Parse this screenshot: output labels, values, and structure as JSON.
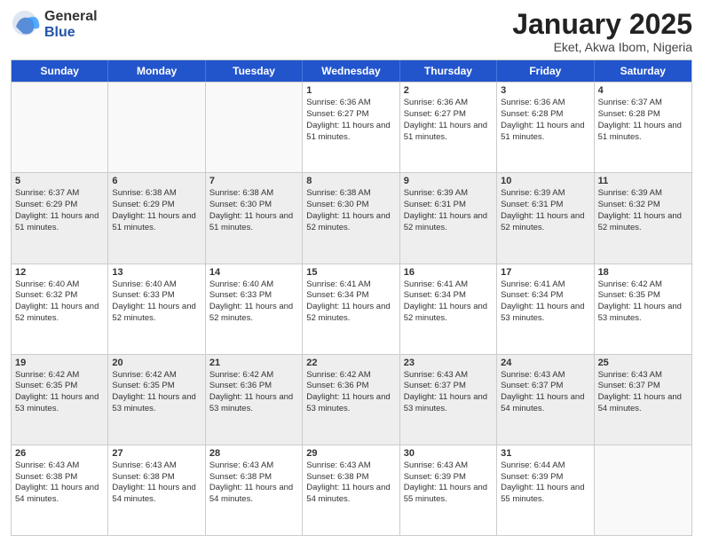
{
  "logo": {
    "general": "General",
    "blue": "Blue"
  },
  "title": {
    "month": "January 2025",
    "location": "Eket, Akwa Ibom, Nigeria"
  },
  "header_days": [
    "Sunday",
    "Monday",
    "Tuesday",
    "Wednesday",
    "Thursday",
    "Friday",
    "Saturday"
  ],
  "weeks": [
    [
      {
        "day": "",
        "empty": true
      },
      {
        "day": "",
        "empty": true
      },
      {
        "day": "",
        "empty": true
      },
      {
        "day": "1",
        "sunrise": "Sunrise: 6:36 AM",
        "sunset": "Sunset: 6:27 PM",
        "daylight": "Daylight: 11 hours and 51 minutes."
      },
      {
        "day": "2",
        "sunrise": "Sunrise: 6:36 AM",
        "sunset": "Sunset: 6:27 PM",
        "daylight": "Daylight: 11 hours and 51 minutes."
      },
      {
        "day": "3",
        "sunrise": "Sunrise: 6:36 AM",
        "sunset": "Sunset: 6:28 PM",
        "daylight": "Daylight: 11 hours and 51 minutes."
      },
      {
        "day": "4",
        "sunrise": "Sunrise: 6:37 AM",
        "sunset": "Sunset: 6:28 PM",
        "daylight": "Daylight: 11 hours and 51 minutes."
      }
    ],
    [
      {
        "day": "5",
        "sunrise": "Sunrise: 6:37 AM",
        "sunset": "Sunset: 6:29 PM",
        "daylight": "Daylight: 11 hours and 51 minutes."
      },
      {
        "day": "6",
        "sunrise": "Sunrise: 6:38 AM",
        "sunset": "Sunset: 6:29 PM",
        "daylight": "Daylight: 11 hours and 51 minutes."
      },
      {
        "day": "7",
        "sunrise": "Sunrise: 6:38 AM",
        "sunset": "Sunset: 6:30 PM",
        "daylight": "Daylight: 11 hours and 51 minutes."
      },
      {
        "day": "8",
        "sunrise": "Sunrise: 6:38 AM",
        "sunset": "Sunset: 6:30 PM",
        "daylight": "Daylight: 11 hours and 52 minutes."
      },
      {
        "day": "9",
        "sunrise": "Sunrise: 6:39 AM",
        "sunset": "Sunset: 6:31 PM",
        "daylight": "Daylight: 11 hours and 52 minutes."
      },
      {
        "day": "10",
        "sunrise": "Sunrise: 6:39 AM",
        "sunset": "Sunset: 6:31 PM",
        "daylight": "Daylight: 11 hours and 52 minutes."
      },
      {
        "day": "11",
        "sunrise": "Sunrise: 6:39 AM",
        "sunset": "Sunset: 6:32 PM",
        "daylight": "Daylight: 11 hours and 52 minutes."
      }
    ],
    [
      {
        "day": "12",
        "sunrise": "Sunrise: 6:40 AM",
        "sunset": "Sunset: 6:32 PM",
        "daylight": "Daylight: 11 hours and 52 minutes."
      },
      {
        "day": "13",
        "sunrise": "Sunrise: 6:40 AM",
        "sunset": "Sunset: 6:33 PM",
        "daylight": "Daylight: 11 hours and 52 minutes."
      },
      {
        "day": "14",
        "sunrise": "Sunrise: 6:40 AM",
        "sunset": "Sunset: 6:33 PM",
        "daylight": "Daylight: 11 hours and 52 minutes."
      },
      {
        "day": "15",
        "sunrise": "Sunrise: 6:41 AM",
        "sunset": "Sunset: 6:34 PM",
        "daylight": "Daylight: 11 hours and 52 minutes."
      },
      {
        "day": "16",
        "sunrise": "Sunrise: 6:41 AM",
        "sunset": "Sunset: 6:34 PM",
        "daylight": "Daylight: 11 hours and 52 minutes."
      },
      {
        "day": "17",
        "sunrise": "Sunrise: 6:41 AM",
        "sunset": "Sunset: 6:34 PM",
        "daylight": "Daylight: 11 hours and 53 minutes."
      },
      {
        "day": "18",
        "sunrise": "Sunrise: 6:42 AM",
        "sunset": "Sunset: 6:35 PM",
        "daylight": "Daylight: 11 hours and 53 minutes."
      }
    ],
    [
      {
        "day": "19",
        "sunrise": "Sunrise: 6:42 AM",
        "sunset": "Sunset: 6:35 PM",
        "daylight": "Daylight: 11 hours and 53 minutes."
      },
      {
        "day": "20",
        "sunrise": "Sunrise: 6:42 AM",
        "sunset": "Sunset: 6:35 PM",
        "daylight": "Daylight: 11 hours and 53 minutes."
      },
      {
        "day": "21",
        "sunrise": "Sunrise: 6:42 AM",
        "sunset": "Sunset: 6:36 PM",
        "daylight": "Daylight: 11 hours and 53 minutes."
      },
      {
        "day": "22",
        "sunrise": "Sunrise: 6:42 AM",
        "sunset": "Sunset: 6:36 PM",
        "daylight": "Daylight: 11 hours and 53 minutes."
      },
      {
        "day": "23",
        "sunrise": "Sunrise: 6:43 AM",
        "sunset": "Sunset: 6:37 PM",
        "daylight": "Daylight: 11 hours and 53 minutes."
      },
      {
        "day": "24",
        "sunrise": "Sunrise: 6:43 AM",
        "sunset": "Sunset: 6:37 PM",
        "daylight": "Daylight: 11 hours and 54 minutes."
      },
      {
        "day": "25",
        "sunrise": "Sunrise: 6:43 AM",
        "sunset": "Sunset: 6:37 PM",
        "daylight": "Daylight: 11 hours and 54 minutes."
      }
    ],
    [
      {
        "day": "26",
        "sunrise": "Sunrise: 6:43 AM",
        "sunset": "Sunset: 6:38 PM",
        "daylight": "Daylight: 11 hours and 54 minutes."
      },
      {
        "day": "27",
        "sunrise": "Sunrise: 6:43 AM",
        "sunset": "Sunset: 6:38 PM",
        "daylight": "Daylight: 11 hours and 54 minutes."
      },
      {
        "day": "28",
        "sunrise": "Sunrise: 6:43 AM",
        "sunset": "Sunset: 6:38 PM",
        "daylight": "Daylight: 11 hours and 54 minutes."
      },
      {
        "day": "29",
        "sunrise": "Sunrise: 6:43 AM",
        "sunset": "Sunset: 6:38 PM",
        "daylight": "Daylight: 11 hours and 54 minutes."
      },
      {
        "day": "30",
        "sunrise": "Sunrise: 6:43 AM",
        "sunset": "Sunset: 6:39 PM",
        "daylight": "Daylight: 11 hours and 55 minutes."
      },
      {
        "day": "31",
        "sunrise": "Sunrise: 6:44 AM",
        "sunset": "Sunset: 6:39 PM",
        "daylight": "Daylight: 11 hours and 55 minutes."
      },
      {
        "day": "",
        "empty": true
      }
    ]
  ]
}
